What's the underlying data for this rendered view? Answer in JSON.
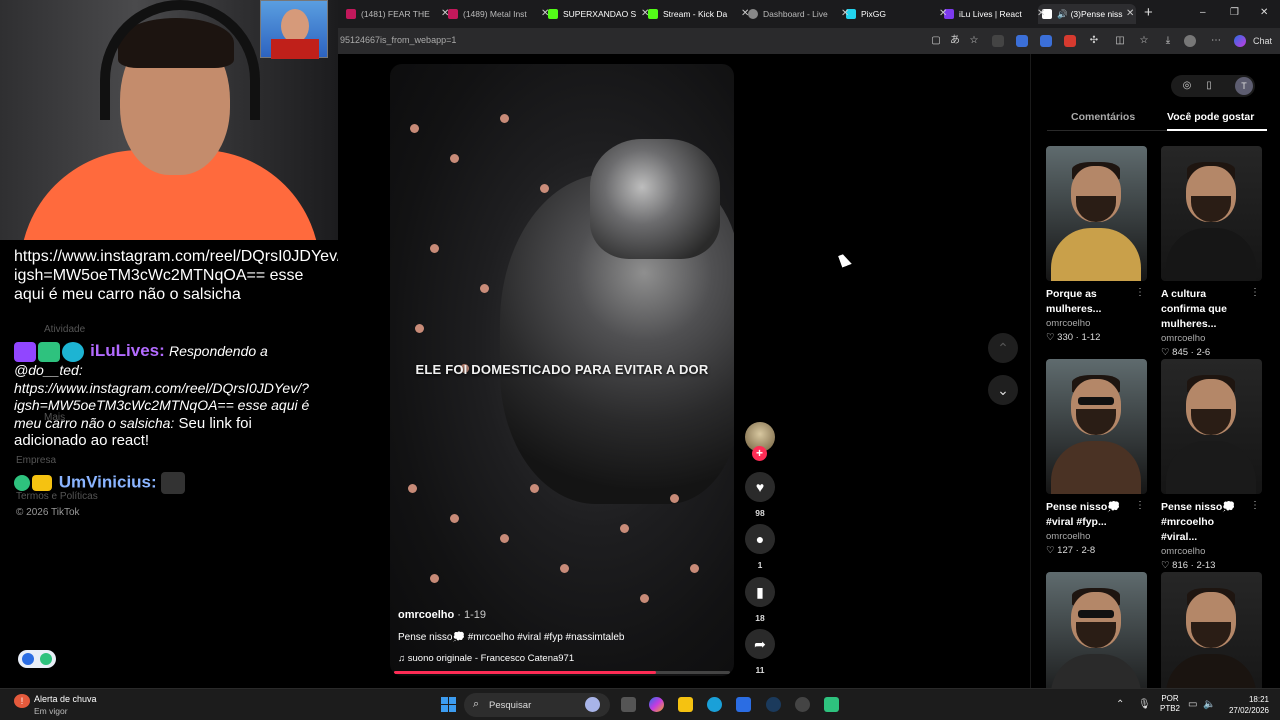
{
  "browser": {
    "tabs": [
      {
        "label": "(1481) FEAR THE",
        "color": "#c2185b"
      },
      {
        "label": "(1489) Metal Inst",
        "color": "#c2185b"
      },
      {
        "label": "SUPERXANDAO S",
        "color": "#53fc18"
      },
      {
        "label": "Stream - Kick Da",
        "color": "#53fc18"
      },
      {
        "label": "Dashboard - Live",
        "color": "#888888"
      },
      {
        "label": "PixGG",
        "color": "#22d3ee"
      },
      {
        "label": "iLu Lives | React",
        "color": "#7c3aed"
      },
      {
        "label": "(3)Pense niss",
        "color": "#ffffff"
      }
    ],
    "new_tab": "+",
    "url": "95124667is_from_webapp=1",
    "chat_button": "Chat",
    "window_controls": {
      "minimize": "–",
      "restore": "❐",
      "close": "✕"
    }
  },
  "stream_chat": {
    "messages": [
      {
        "text": "https://www.instagram.com/reel/DQrsI0JDYev/?igsh=MW5oeTM3cWc2MTNqOA== esse aqui é meu carro não o salsicha"
      },
      {
        "name": "iLuLives:",
        "reply": "Respondendo a @do__ted: https://www.instagram.com/reel/DQrsI0JDYev/?igsh=MW5oeTM3cWc2MTNqOA== esse aqui é meu carro não o salsicha:",
        "text": " Seu link foi adicionado ao react!"
      },
      {
        "name": "UmVinicius:"
      }
    ],
    "sidebar_ghost": [
      "Atividade",
      "Mais",
      "Empresa",
      "Termos e Políticas",
      "© 2026 TikTok"
    ]
  },
  "video": {
    "caption": "ELE FOI DOMESTICADO PARA EVITAR A DOR",
    "author": "omrcoelho",
    "date": " · 1-19",
    "description": "Pense nisso💭 #mrcoelho #viral #fyp #nassimtaleb",
    "sound": "♫  suono originale - Francesco Catena971",
    "progress": 0.78,
    "likes": "98",
    "comments": "1",
    "saves": "18",
    "shares": "11"
  },
  "right_panel": {
    "avatar_letter": "T",
    "tab_comments": "Comentários",
    "tab_suggested": "Você pode gostar",
    "cards": [
      {
        "title": "Porque as mulheres...",
        "author": "omrcoelho",
        "stats": "♡ 330 · 1-12",
        "body_color": "#c9a04a"
      },
      {
        "title": "A cultura confirma que mulheres...",
        "author": "omrcoelho",
        "stats": "♡ 845 · 2-6",
        "body_color": "#161616"
      },
      {
        "title": "Pense nisso💭 #viral #fyp...",
        "author": "omrcoelho",
        "stats": "♡ 127 · 2-8",
        "body_color": "#4a3224"
      },
      {
        "title": "Pense nisso💭 #mrcoelho #viral...",
        "author": "omrcoelho",
        "stats": "♡ 816 · 2-13",
        "body_color": "#1a1a1a"
      },
      {
        "title": "",
        "author": "",
        "stats": "",
        "body_color": "#2a2a2a"
      },
      {
        "title": "",
        "author": "",
        "stats": "",
        "body_color": "#1a1410"
      }
    ]
  },
  "taskbar": {
    "weather_title": "Alerta de chuva",
    "weather_sub": "Em vigor",
    "search_placeholder": "Pesquisar",
    "lang_1": "POR",
    "lang_2": "PTB2",
    "time": "18:21",
    "date": "27/02/2026"
  }
}
